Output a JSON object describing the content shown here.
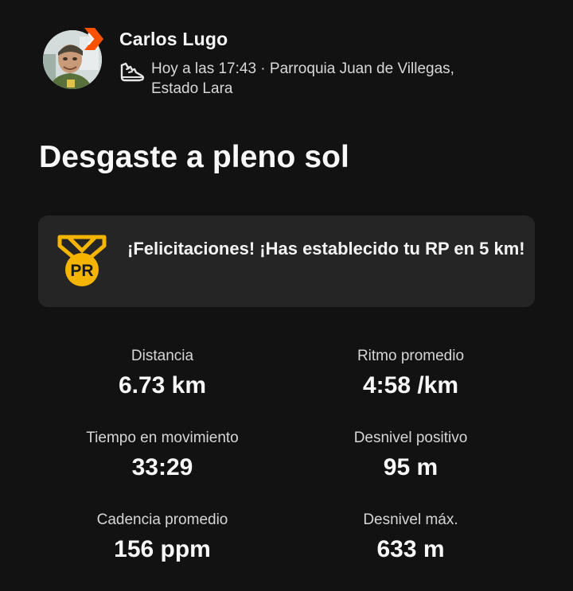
{
  "athlete": {
    "name": "Carlos Lugo",
    "avatar_icon": "user-avatar-photo",
    "badge_icon": "strava-subscriber-chevron-icon",
    "badge_color": "#fc5200"
  },
  "activity": {
    "sport_icon": "running-shoe-icon",
    "meta": "Hoy a las 17:43 · Parroquia Juan de Villegas, Estado Lara",
    "title": "Desgaste a pleno sol"
  },
  "achievement": {
    "icon": "pr-medal-icon",
    "icon_label": "PR",
    "icon_color": "#f4b400",
    "message": "¡Felicitaciones! ¡Has establecido tu RP en 5 km!"
  },
  "stats": [
    {
      "label": "Distancia",
      "value": "6.73 km"
    },
    {
      "label": "Ritmo promedio",
      "value": "4:58 /km"
    },
    {
      "label": "Tiempo en movimiento",
      "value": "33:29"
    },
    {
      "label": "Desnivel positivo",
      "value": "95 m"
    },
    {
      "label": "Cadencia promedio",
      "value": "156 ppm"
    },
    {
      "label": "Desnivel máx.",
      "value": "633 m"
    }
  ]
}
